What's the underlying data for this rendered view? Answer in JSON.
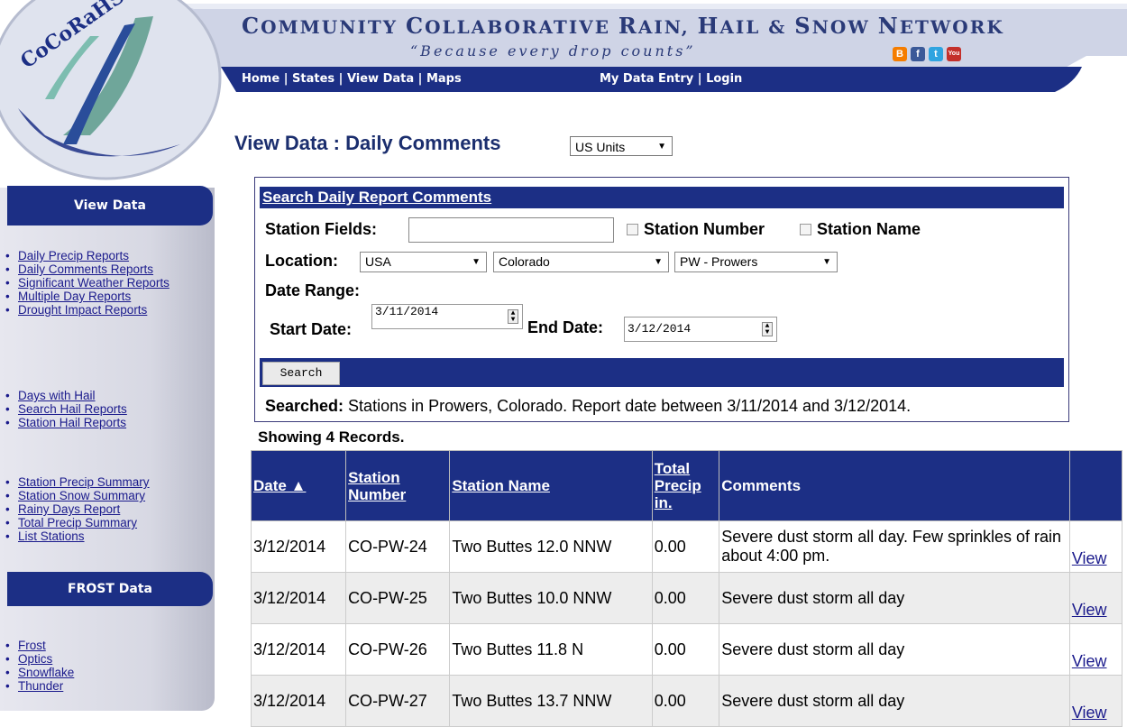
{
  "header": {
    "logo_text": "CoCoRaHS",
    "title_parts": [
      {
        "cap": "C",
        "rest": "OMMUNITY "
      },
      {
        "cap": "C",
        "rest": "OLLABORATIVE "
      },
      {
        "cap": "R",
        "rest": "AIN, "
      },
      {
        "cap": "H",
        "rest": "AIL & "
      },
      {
        "cap": "S",
        "rest": "NOW "
      },
      {
        "cap": "N",
        "rest": "ETWORK"
      }
    ],
    "tagline": "“Because every drop counts”",
    "social_icons": [
      {
        "name": "blogger-icon",
        "glyph": "B",
        "color": "#f57d00"
      },
      {
        "name": "facebook-icon",
        "glyph": "f",
        "color": "#3b5998"
      },
      {
        "name": "twitter-icon",
        "glyph": "t",
        "color": "#2fa4e0"
      },
      {
        "name": "youtube-icon",
        "glyph": "You",
        "color": "#c4302b"
      }
    ]
  },
  "nav": {
    "home": "Home",
    "states": "States",
    "view_data": "View Data",
    "maps": "Maps",
    "my_data_entry": "My Data Entry",
    "login": "Login",
    "sep": " | "
  },
  "sidebar": {
    "view_data_title": "View Data",
    "group1": [
      "Daily Precip Reports",
      "Daily Comments Reports",
      "Significant Weather Reports",
      "Multiple Day Reports",
      "Drought Impact Reports"
    ],
    "group2": [
      "Days with Hail",
      "Search Hail Reports",
      "Station Hail Reports"
    ],
    "group3": [
      "Station Precip Summary",
      "Station Snow Summary",
      "Rainy Days Report",
      "Total Precip Summary",
      "List Stations"
    ],
    "frost_title": "FROST Data",
    "group4": [
      "Frost",
      "Optics",
      "Snowflake",
      "Thunder"
    ]
  },
  "main": {
    "heading": "View Data : Daily Comments",
    "units": "US Units"
  },
  "search": {
    "title": "Search Daily Report Comments",
    "station_fields_label": "Station Fields:",
    "station_number_label": "Station Number",
    "station_name_label": "Station Name",
    "location_label": "Location:",
    "country": "USA",
    "state": "Colorado",
    "county": "PW - Prowers",
    "date_range_label": "Date Range:",
    "start_date_label": "Start Date:",
    "start_date": "3/11/2014",
    "end_date_label": "End Date:",
    "end_date": "3/12/2014",
    "button": "Search",
    "searched_label": "Searched:",
    "searched_text": " Stations in Prowers, Colorado. Report date between 3/11/2014 and 3/12/2014."
  },
  "results": {
    "showing": "Showing 4 Records.",
    "columns": {
      "date": "Date ▲",
      "station_number": "Station Number",
      "station_name": "Station Name",
      "total_precip": "Total Precip in.",
      "comments": "Comments"
    },
    "view_label": "View",
    "rows": [
      {
        "date": "3/12/2014",
        "number": "CO-PW-24",
        "name": "Two Buttes 12.0 NNW",
        "precip": "0.00",
        "comments": "Severe dust storm all day. Few sprinkles of rain about 4:00 pm."
      },
      {
        "date": "3/12/2014",
        "number": "CO-PW-25",
        "name": "Two Buttes 10.0 NNW",
        "precip": "0.00",
        "comments": "Severe dust storm all day"
      },
      {
        "date": "3/12/2014",
        "number": "CO-PW-26",
        "name": "Two Buttes 11.8 N",
        "precip": "0.00",
        "comments": "Severe dust storm all day"
      },
      {
        "date": "3/12/2014",
        "number": "CO-PW-27",
        "name": "Two Buttes 13.7 NNW",
        "precip": "0.00",
        "comments": "Severe dust storm all day"
      }
    ]
  }
}
